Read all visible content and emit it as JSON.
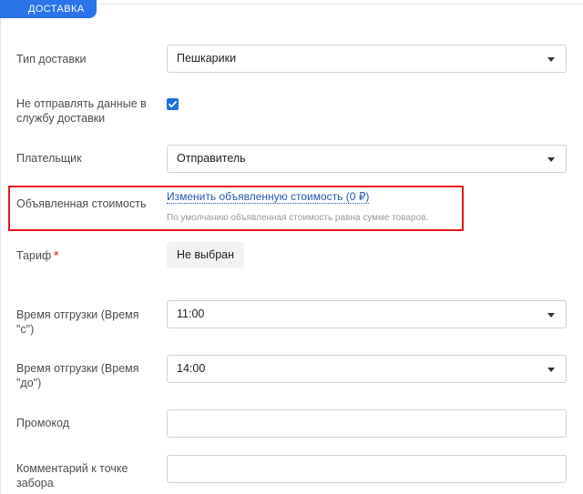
{
  "section": {
    "title": "ДОСТАВКА"
  },
  "fields": {
    "delivery_type": {
      "label": "Тип доставки",
      "value": "Пешкарики"
    },
    "no_send": {
      "label_line1": "Не отправлять данные в",
      "label_line2": "службу доставки",
      "checked": true
    },
    "payer": {
      "label": "Плательщик",
      "value": "Отправитель"
    },
    "declared_value": {
      "label": "Объявленная стоимость",
      "link_text": "Изменить объявленную стоимость (0 ₽)",
      "hint": "По умолчанию объявленная стоимость равна сумме товаров."
    },
    "tariff": {
      "label": "Тариф",
      "required_mark": "*",
      "button": "Не выбран"
    },
    "ship_time_from": {
      "label_line1": "Время отгрузки (Время",
      "label_line2": "\"с\")",
      "value": "11:00"
    },
    "ship_time_to": {
      "label_line1": "Время отгрузки (Время",
      "label_line2": "\"до\")",
      "value": "14:00"
    },
    "promo": {
      "label": "Промокод",
      "value": ""
    },
    "comment": {
      "label_line1": "Комментарий к точке",
      "label_line2": "забора",
      "value": ""
    }
  },
  "colors": {
    "accent": "#2a73e8",
    "highlight": "#e8151b",
    "link": "#2456b5"
  }
}
